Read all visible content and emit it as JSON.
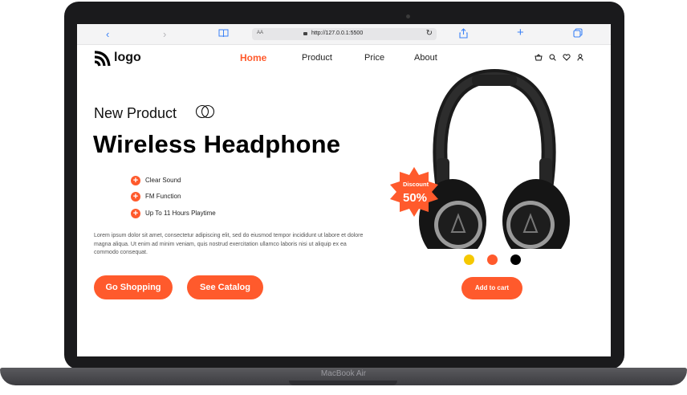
{
  "device": {
    "label": "MacBook Air"
  },
  "browser": {
    "text_size_label": "AA",
    "url": "http://127.0.0.1:5500",
    "icons": [
      "back-icon",
      "forward-icon",
      "book-icon",
      "lock-icon",
      "reload-icon",
      "share-icon",
      "new-tab-icon",
      "tabs-icon"
    ]
  },
  "site": {
    "logo_text": "logo",
    "nav": [
      "Home",
      "Product",
      "Price",
      "About"
    ],
    "active_nav": "Home",
    "nav_icons": [
      "basket-icon",
      "search-icon",
      "heart-icon",
      "user-icon"
    ]
  },
  "hero": {
    "eyebrow": "New Product",
    "title": "Wireless Headphone",
    "features": [
      "Clear Sound",
      "FM Function",
      "Up To 11 Hours Playtime"
    ],
    "description": "Lorem ipsum dolor sit amet, consectetur adipiscing elit, sed do eiusmod tempor incididunt ut labore et dolore magna aliqua. Ut enim ad minim veniam, quis nostrud exercitation ullamco laboris nisi ut aliquip ex ea commodo consequat.",
    "primary_button": "Go Shopping",
    "secondary_button": "See Catalog"
  },
  "product": {
    "badge_label": "Discount",
    "badge_value": "50%",
    "color_options": [
      "#f5c800",
      "#ff5a2c",
      "#000000"
    ],
    "cart_button": "Add to cart"
  },
  "colors": {
    "accent": "#ff5a2c",
    "browser_blue": "#3b82f6"
  }
}
